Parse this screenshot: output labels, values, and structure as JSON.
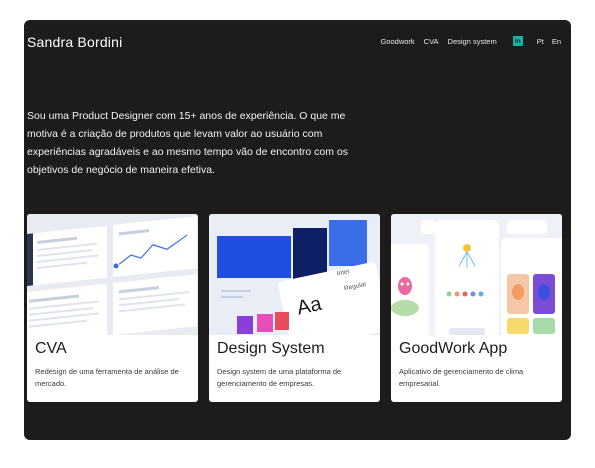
{
  "header": {
    "brand": "Sandra Bordini",
    "nav": [
      "Goodwork",
      "CVA",
      "Design system"
    ],
    "linkedin_icon": "linkedin-icon",
    "lang_pt": "Pt",
    "lang_en": "En"
  },
  "intro": "Sou uma Product Designer com 15+ anos de experiência. O que me motiva é a criação de produtos que levam valor ao usuário com experiências agradáveis e ao mesmo tempo vão de encontro com os objetivos de negócio de maneira efetiva.",
  "cards": [
    {
      "title": "CVA",
      "description": "Redesign de uma ferramenta de análise de mercado."
    },
    {
      "title": "Design System",
      "description": "Design system de uma plataforma de gerenciamento de empresas.",
      "thumb_text": [
        "Aa",
        "Inter",
        "Regular"
      ]
    },
    {
      "title": "GoodWork App",
      "description": "Aplicativo de gerenciamento de clima empresarial."
    }
  ],
  "colors": {
    "background": "#1c1c1c",
    "accent": "#0fb8a6",
    "ds_blue": "#1f4fe0",
    "ds_navy": "#0e1f66"
  }
}
